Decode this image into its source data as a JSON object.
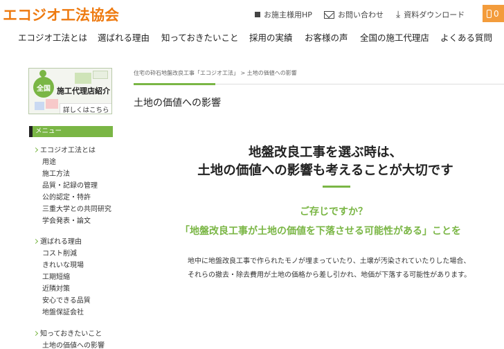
{
  "header": {
    "logo": "エコジオ工法協会",
    "util_links": [
      {
        "label": "お施主様用HP",
        "icon": "square-icon"
      },
      {
        "label": "お問い合わせ",
        "icon": "envelope-icon"
      },
      {
        "label": "資料ダウンロード",
        "icon": "download-icon"
      }
    ],
    "cart_count": "0"
  },
  "nav": {
    "items": [
      "エコジオ工法とは",
      "選ばれる理由",
      "知っておきたいこと",
      "採用の実績",
      "お客様の声",
      "全国の施工代理店",
      "よくある質問"
    ]
  },
  "sidebar": {
    "banner": {
      "badge": "全国",
      "title": "施工代理店紹介",
      "link": "詳しくはこちら"
    },
    "menu_heading": "メニュー",
    "sections": [
      {
        "title": "エコジオ工法とは",
        "items": [
          "用途",
          "施工方法",
          "品質・記録の管理",
          "公的認定・特許",
          "三重大学との共同研究",
          "学会発表・論文"
        ]
      },
      {
        "title": "選ばれる理由",
        "items": [
          "コスト削減",
          "きれいな現場",
          "工期短縮",
          "近隣対策",
          "安心できる品質",
          "地盤保証会社"
        ]
      },
      {
        "title": "知っておきたいこと",
        "items": [
          "土地の価値への影響"
        ]
      }
    ]
  },
  "main": {
    "breadcrumb": "住宅の砕石地盤改良工事「エコジオ工法」 > 土地の価値への影響",
    "page_title": "土地の価値への影響",
    "headline": [
      "地盤改良工事を選ぶ時は、",
      "土地の価値への影響も考えることが大切です"
    ],
    "question": "ご存じですか？",
    "statement": "「地盤改良工事が土地の価値を下落させる可能性がある」ことを",
    "body": [
      "地中に地盤改良工事で作られたモノが埋まっていたり、土壌が汚染されていたりした場合、",
      "それらの撤去・除去費用が土地の価格から差し引かれ、地価が下落する可能性があります。"
    ]
  },
  "colors": {
    "brand_orange": "#ee7a10",
    "accent_green": "#7ab645"
  }
}
